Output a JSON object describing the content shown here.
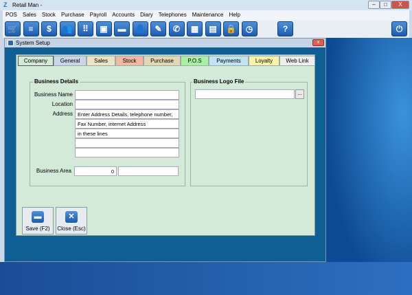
{
  "window": {
    "title": "Retail Man -",
    "min": "–",
    "max": "□",
    "close": "X"
  },
  "menu": [
    "POS",
    "Sales",
    "Stock",
    "Purchase",
    "Payroll",
    "Accounts",
    "Diary",
    "Telephones",
    "Maintenance",
    "Help"
  ],
  "toolbar": [
    {
      "name": "cart-icon",
      "glyph": "🛒"
    },
    {
      "name": "document-icon",
      "glyph": "≡"
    },
    {
      "name": "dollar-icon",
      "glyph": "$"
    },
    {
      "name": "users-icon",
      "glyph": "👥"
    },
    {
      "name": "chart-icon",
      "glyph": "⠿"
    },
    {
      "name": "box-icon",
      "glyph": "▣"
    },
    {
      "name": "card-icon",
      "glyph": "▬"
    },
    {
      "name": "user-icon",
      "glyph": "👤"
    },
    {
      "name": "edit-icon",
      "glyph": "✎"
    },
    {
      "name": "phone-icon",
      "glyph": "✆"
    },
    {
      "name": "grid-icon",
      "glyph": "▦"
    },
    {
      "name": "calculator-icon",
      "glyph": "▤"
    },
    {
      "name": "lock-icon",
      "glyph": "🔒"
    },
    {
      "name": "clock-icon",
      "glyph": "◷"
    }
  ],
  "help_glyph": "?",
  "power_glyph": "⏻",
  "dialog": {
    "title": "System Setup",
    "close": "x",
    "tabs": [
      {
        "label": "Company",
        "color": "#d3ead8"
      },
      {
        "label": "General",
        "color": "#c9d6ea"
      },
      {
        "label": "Sales",
        "color": "#ece2c4"
      },
      {
        "label": "Stock",
        "color": "#f4b7a3"
      },
      {
        "label": "Purchase",
        "color": "#e4d7b6"
      },
      {
        "label": "P.O.S",
        "color": "#a9f0a4"
      },
      {
        "label": "Payments",
        "color": "#bfe4f3"
      },
      {
        "label": "Loyalty",
        "color": "#f8f3a8"
      },
      {
        "label": "Web Link",
        "color": "#eeeeee"
      }
    ],
    "business_details": {
      "title": "Business Details",
      "name_label": "Business Name",
      "location_label": "Location",
      "address_label": "Address",
      "address_lines": [
        "Enter Address Details, telephone number,",
        "Fax Number, internet Address",
        "in these lines",
        "",
        ""
      ],
      "area_label": "Business Area",
      "area_value": "0"
    },
    "logo": {
      "title": "Business Logo File",
      "browse": "..."
    },
    "save": "Save (F2)",
    "close_btn": "Close (Esc)"
  }
}
